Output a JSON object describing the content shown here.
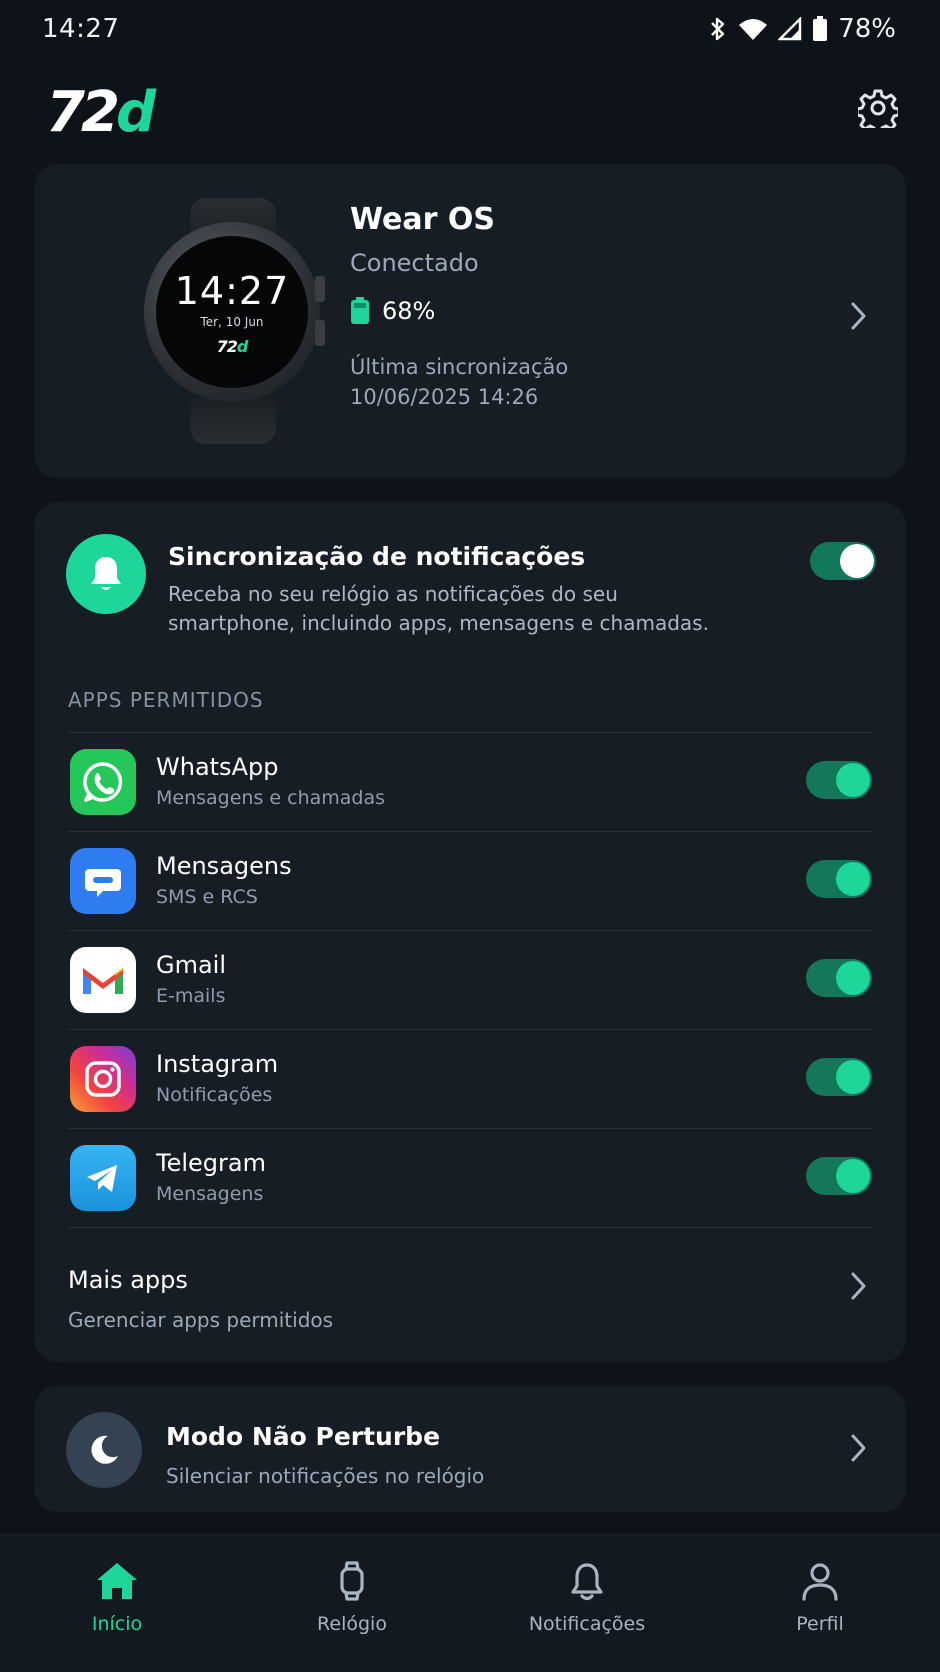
{
  "status_bar": {
    "time": "14:27",
    "battery": "78%",
    "icons": [
      "bluetooth-icon",
      "wifi-icon",
      "signal-icon",
      "battery-icon"
    ]
  },
  "header": {
    "logo_num": "72",
    "logo_d": "d",
    "settings_icon": "gear-icon"
  },
  "device": {
    "watch_time": "14:27",
    "watch_date": "Ter, 10 Jun",
    "watch_logo_num": "72",
    "watch_logo_d": "d",
    "name": "Wear OS",
    "status": "Conectado",
    "battery": "68%",
    "sync_label": "Última sincronização",
    "sync_date": "10/06/2025 14:26"
  },
  "notifications": {
    "title": "Sincronização de notificações",
    "description": "Receba no seu relógio as notificações do seu smartphone, incluindo apps, mensagens e chamadas.",
    "enabled": true,
    "section_label": "APPS PERMITIDOS",
    "apps": [
      {
        "name": "WhatsApp",
        "sub": "Mensagens e chamadas",
        "icon": "whatsapp-icon",
        "enabled": true
      },
      {
        "name": "Mensagens",
        "sub": "SMS e RCS",
        "icon": "messages-icon",
        "enabled": true
      },
      {
        "name": "Gmail",
        "sub": "E-mails",
        "icon": "gmail-icon",
        "enabled": true
      },
      {
        "name": "Instagram",
        "sub": "Notificações",
        "icon": "instagram-icon",
        "enabled": true
      },
      {
        "name": "Telegram",
        "sub": "Mensagens",
        "icon": "telegram-icon",
        "enabled": true
      }
    ],
    "more_title": "Mais apps",
    "more_sub": "Gerenciar apps permitidos"
  },
  "dnd": {
    "title": "Modo Não Perturbe",
    "sub": "Silenciar notificações no relógio"
  },
  "nav": {
    "items": [
      {
        "label": "Início",
        "icon": "home-icon",
        "active": true
      },
      {
        "label": "Relógio",
        "icon": "watch-icon",
        "active": false
      },
      {
        "label": "Notificações",
        "icon": "bell-icon",
        "active": false
      },
      {
        "label": "Perfil",
        "icon": "profile-icon",
        "active": false
      }
    ]
  },
  "colors": {
    "accent": "#1fd69a",
    "background": "#0d1319",
    "card": "#161d25"
  }
}
